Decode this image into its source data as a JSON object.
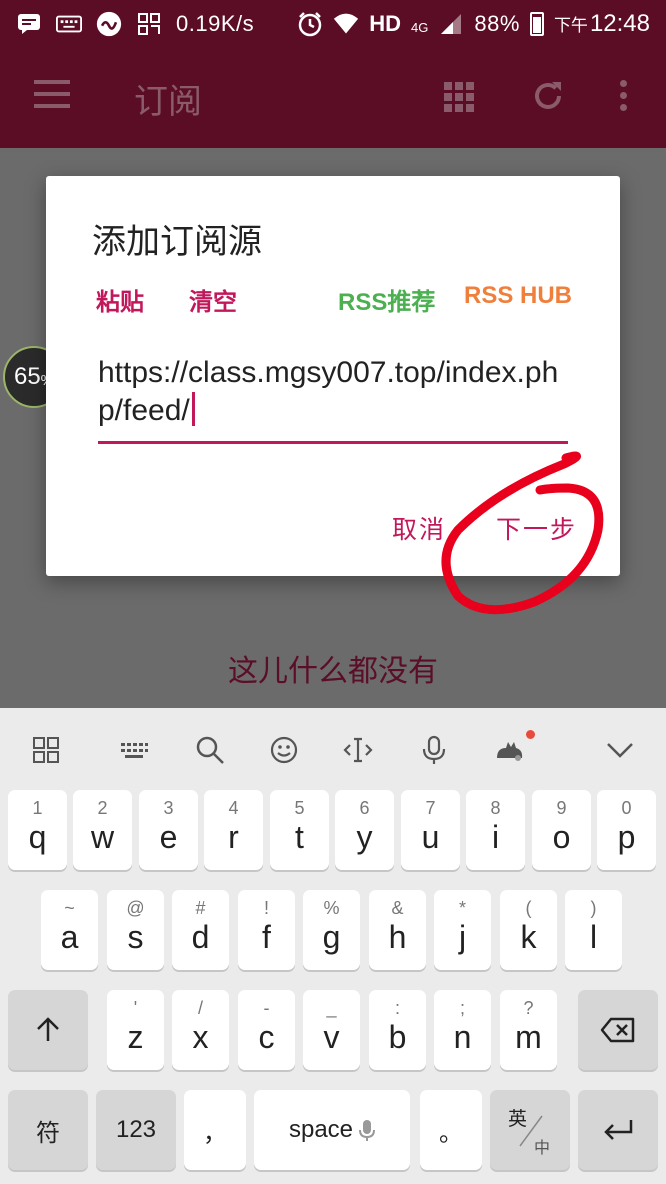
{
  "status_bar": {
    "speed": "0.19K/s",
    "hd": "HD",
    "net": "4G",
    "battery": "88%",
    "time_prefix": "下午",
    "time": "12:48"
  },
  "app_bar": {
    "title": "订阅",
    "icons": [
      "menu-icon",
      "grid-icon",
      "refresh-icon",
      "more-vert-icon"
    ]
  },
  "empty_state": "这儿什么都没有",
  "float_badge": {
    "value": "65",
    "unit": "%"
  },
  "dialog": {
    "title": "添加订阅源",
    "actions": {
      "paste": "粘贴",
      "clear": "清空",
      "rss_recommend": "RSS推荐",
      "rss_hub": "RSS HUB"
    },
    "url_value": "https://class.mgsy007.top/index.php/feed/",
    "cancel": "取消",
    "next": "下一步"
  },
  "colors": {
    "app_bar": "#5c0d26",
    "accent": "#c2185b",
    "rss_recommend": "#4caf50",
    "rss_hub": "#f07f3c",
    "annotation": "#e8001c"
  },
  "keyboard": {
    "toolbar": [
      "apps-icon",
      "keyboard-icon",
      "search-icon",
      "emoji-icon",
      "cursor-icon",
      "mic-icon",
      "cat-icon",
      "collapse-icon"
    ],
    "row1": [
      {
        "hint": "1",
        "key": "q"
      },
      {
        "hint": "2",
        "key": "w"
      },
      {
        "hint": "3",
        "key": "e"
      },
      {
        "hint": "4",
        "key": "r"
      },
      {
        "hint": "5",
        "key": "t"
      },
      {
        "hint": "6",
        "key": "y"
      },
      {
        "hint": "7",
        "key": "u"
      },
      {
        "hint": "8",
        "key": "i"
      },
      {
        "hint": "9",
        "key": "o"
      },
      {
        "hint": "0",
        "key": "p"
      }
    ],
    "row2": [
      {
        "hint": "~",
        "key": "a"
      },
      {
        "hint": "@",
        "key": "s"
      },
      {
        "hint": "#",
        "key": "d"
      },
      {
        "hint": "!",
        "key": "f"
      },
      {
        "hint": "%",
        "key": "g"
      },
      {
        "hint": "&",
        "key": "h"
      },
      {
        "hint": "*",
        "key": "j"
      },
      {
        "hint": "(",
        "key": "k"
      },
      {
        "hint": ")",
        "key": "l"
      }
    ],
    "row3": [
      {
        "hint": "'",
        "key": "z"
      },
      {
        "hint": "/",
        "key": "x"
      },
      {
        "hint": "-",
        "key": "c"
      },
      {
        "hint": "_",
        "key": "v"
      },
      {
        "hint": ":",
        "key": "b"
      },
      {
        "hint": ";",
        "key": "n"
      },
      {
        "hint": "?",
        "key": "m"
      }
    ],
    "symbols": "符",
    "num": "123",
    "comma": "，",
    "space": "space",
    "period": "。",
    "lang_top": "英",
    "lang_bottom": "中"
  }
}
